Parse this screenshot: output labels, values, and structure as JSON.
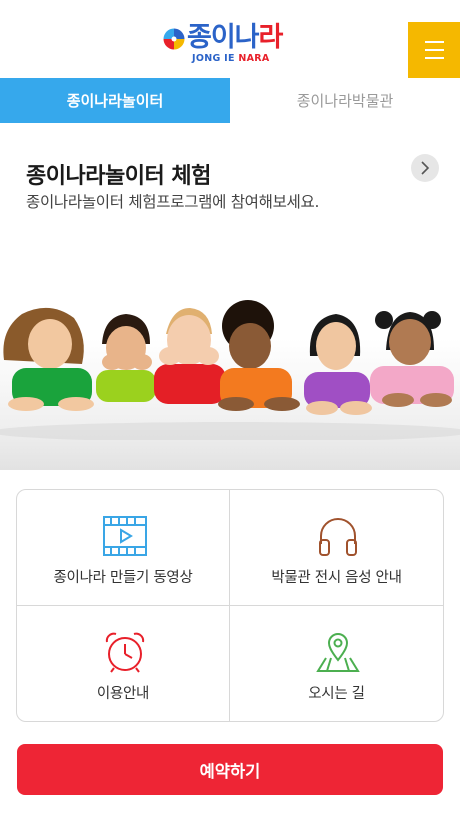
{
  "header": {
    "logo_text": "종이나라",
    "logo_text_part1": "종이나",
    "logo_text_part2": "라",
    "logo_subtext_part1": "JONG IE",
    "logo_subtext_part2": "NARA",
    "menu_icon": "hamburger-icon"
  },
  "tabs": [
    {
      "label": "종이나라놀이터",
      "active": true
    },
    {
      "label": "종이나라박물관",
      "active": false
    }
  ],
  "hero": {
    "title": "종이나라놀이터 체험",
    "subtitle": "종이나라놀이터 체험프로그램에 참여해보세요.",
    "arrow_icon": "chevron-right-icon",
    "image": "children-lying-row-photo"
  },
  "menu_grid": [
    {
      "label": "종이나라 만들기 동영상",
      "icon": "video-icon"
    },
    {
      "label": "박물관 전시 음성 안내",
      "icon": "headphones-icon"
    },
    {
      "label": "이용안내",
      "icon": "alarm-clock-icon"
    },
    {
      "label": "오시는 길",
      "icon": "map-pin-icon"
    }
  ],
  "reserve_button": {
    "label": "예약하기"
  },
  "colors": {
    "tab_active": "#36a8ec",
    "menu_button": "#f5b800",
    "reserve": "#ee2535",
    "icon_video": "#3aa6e6",
    "icon_headphones": "#a0522d",
    "icon_clock": "#e8202a",
    "icon_map": "#4caf50"
  }
}
